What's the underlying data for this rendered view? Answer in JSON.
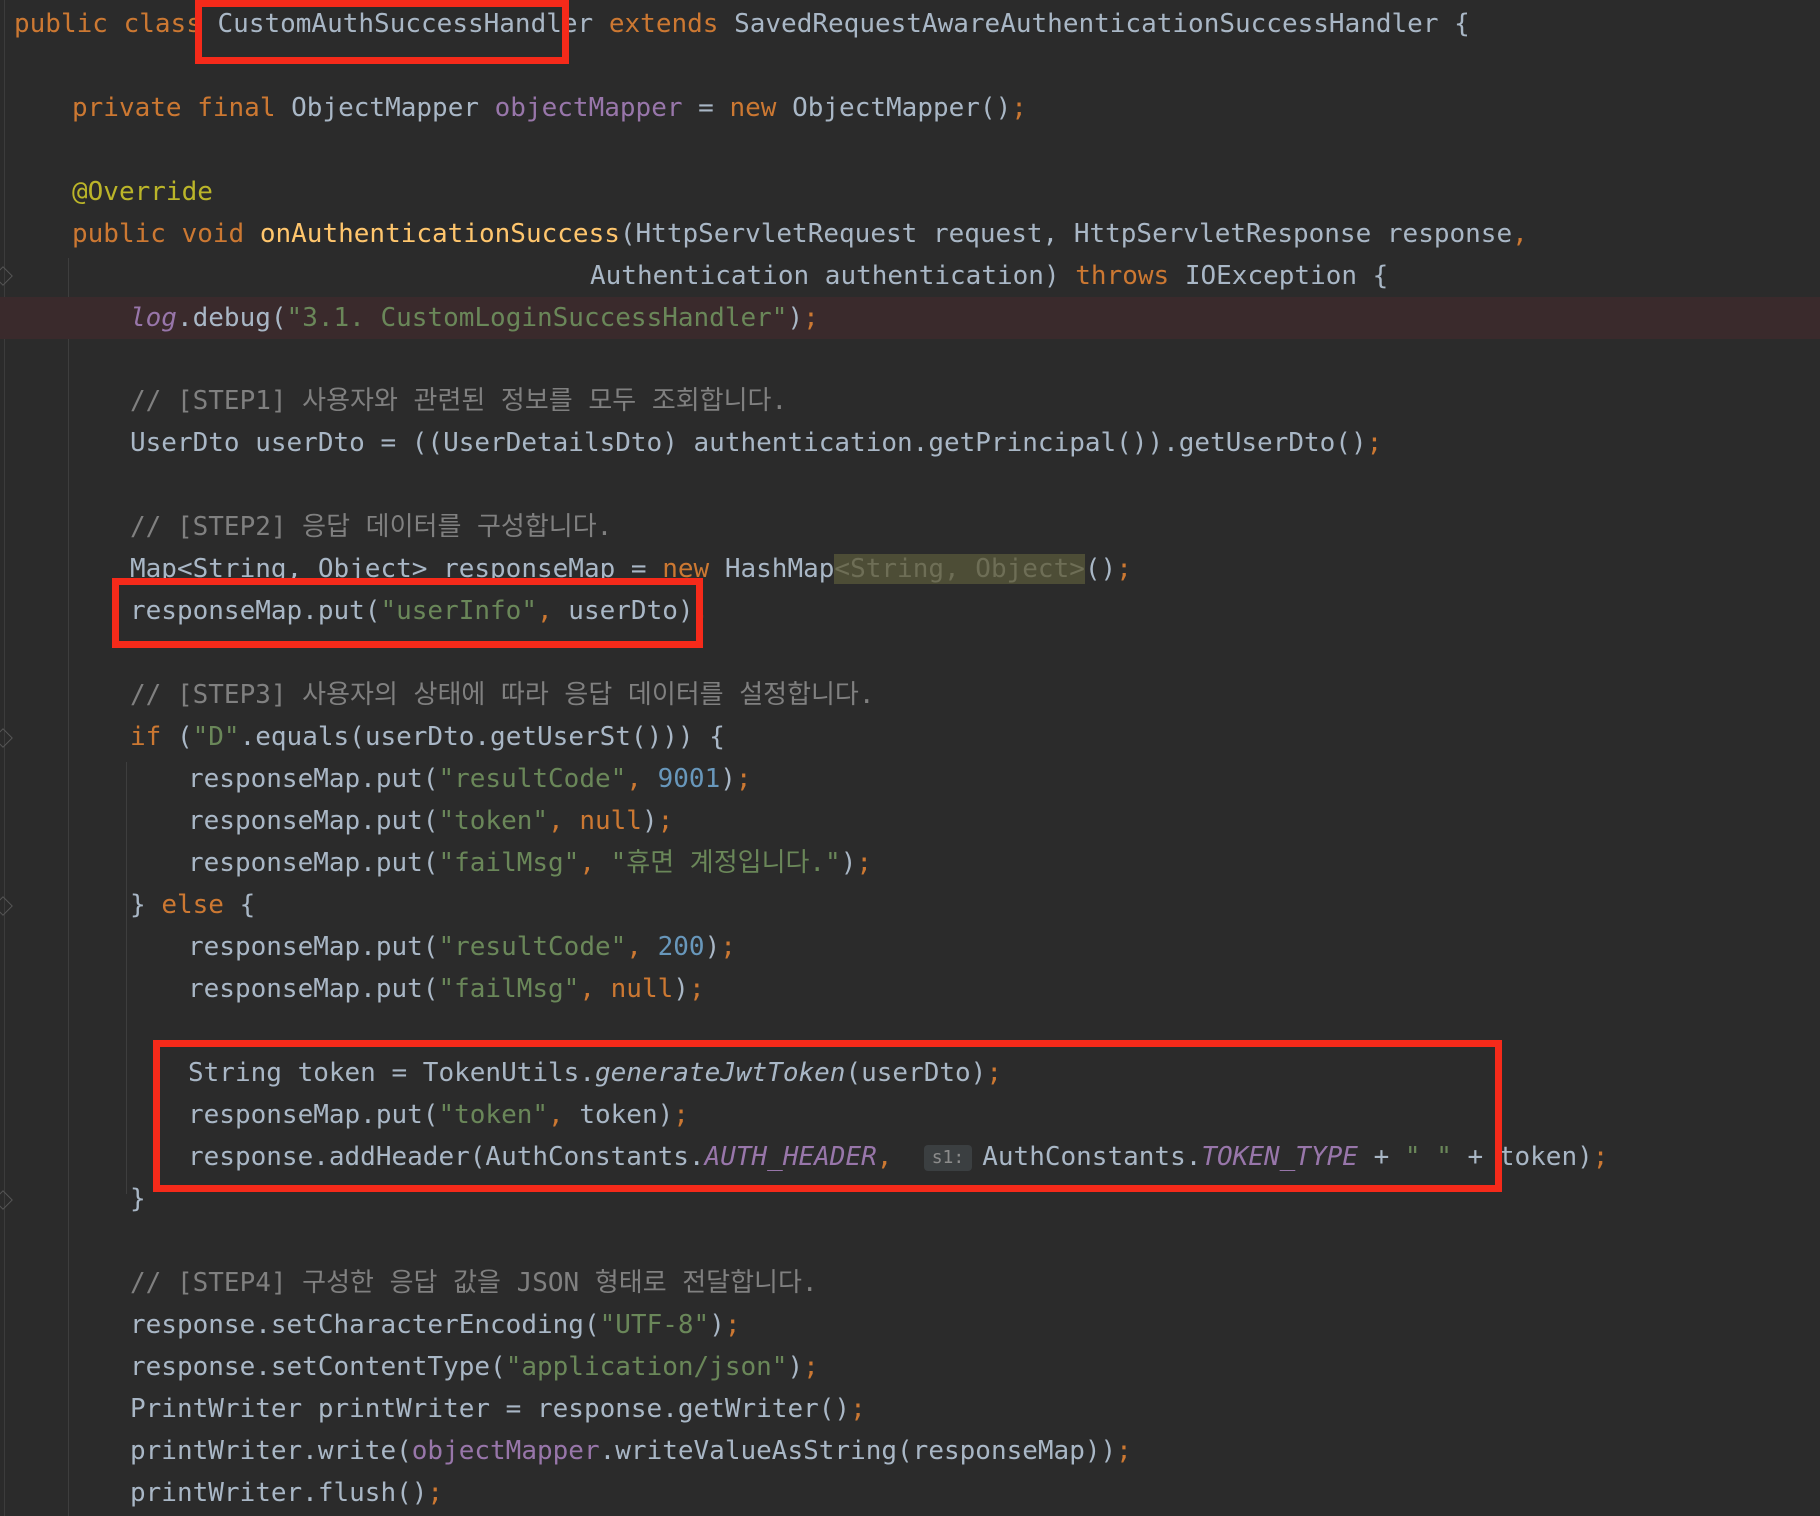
{
  "code": {
    "l1": {
      "pub": "public",
      "cls": "class",
      "name": "CustomAuthSuccessHandler",
      "ext": "extends",
      "parent": "SavedRequestAwareAuthenticationSuccessHandler",
      "brace": "{"
    },
    "l2": {
      "kw": "private final",
      "type": "ObjectMapper",
      "field": "objectMapper",
      "eq": "=",
      "new": "new",
      "ctor": "ObjectMapper()",
      "semi": ";"
    },
    "l3": {
      "ann": "@Override"
    },
    "l4": {
      "kw": "public void",
      "method": "onAuthenticationSuccess",
      "params": "(HttpServletRequest request, HttpServletResponse response",
      "comma": ","
    },
    "l5": {
      "params": "Authentication authentication)",
      "throws": "throws",
      "exc": "IOException {"
    },
    "l6": {
      "log": "log",
      "call": ".debug(",
      "str": "\"3.1. CustomLoginSuccessHandler\"",
      "end": ")",
      "semi": ";"
    },
    "l7": {
      "cmt": "// [STEP1] 사용자와 관련된 정보를 모두 조회합니다."
    },
    "l8": {
      "code": "UserDto userDto = ((UserDetailsDto) authentication.getPrincipal()).getUserDto()",
      "semi": ";"
    },
    "l9": {
      "cmt": "// [STEP2] 응답 데이터를 구성합니다."
    },
    "l10": {
      "a": "Map<String, Object> responseMap = ",
      "new": "new",
      "b": " HashMap",
      "lt": "<",
      "hint": "String, Object",
      "gt": ">",
      "c": "()",
      "semi": ";"
    },
    "l11": {
      "a": "responseMap.put(",
      "str": "\"userInfo\"",
      "comma": ",",
      "b": " userDto)",
      "semi": ";"
    },
    "l12": {
      "cmt": "// [STEP3] 사용자의 상태에 따라 응답 데이터를 설정합니다."
    },
    "l13": {
      "if": "if",
      "a": " (",
      "str": "\"D\"",
      "b": ".equals(userDto.getUserSt())) {"
    },
    "l14": {
      "a": "responseMap.put(",
      "str": "\"resultCode\"",
      "comma": ",",
      "num": "9001",
      "b": ")",
      "semi": ";"
    },
    "l15": {
      "a": "responseMap.put(",
      "str": "\"token\"",
      "comma": ",",
      "null": "null",
      "b": ")",
      "semi": ";"
    },
    "l16": {
      "a": "responseMap.put(",
      "str": "\"failMsg\"",
      "comma": ",",
      "str2": "\"휴면 계정입니다.\"",
      "b": ")",
      "semi": ";"
    },
    "l17": {
      "a": "} ",
      "else": "else",
      "b": " {"
    },
    "l18": {
      "a": "responseMap.put(",
      "str": "\"resultCode\"",
      "comma": ",",
      "num": "200",
      "b": ")",
      "semi": ";"
    },
    "l19": {
      "a": "responseMap.put(",
      "str": "\"failMsg\"",
      "comma": ",",
      "null": "null",
      "b": ")",
      "semi": ";"
    },
    "l20": {
      "a": "String token = TokenUtils.",
      "m": "generateJwtToken",
      "b": "(userDto)",
      "semi": ";"
    },
    "l21": {
      "a": "responseMap.put(",
      "str": "\"token\"",
      "comma": ",",
      "b": " token)",
      "semi": ";"
    },
    "l22": {
      "a": "response.addHeader(AuthConstants.",
      "f1": "AUTH_HEADER",
      "comma": ",",
      "hint": "s1:",
      "b": "AuthConstants.",
      "f2": "TOKEN_TYPE",
      "c": " + ",
      "str": "\" \"",
      "d": " + token)",
      "semi": ";"
    },
    "l23": {
      "a": "}"
    },
    "l24": {
      "cmt": "// [STEP4] 구성한 응답 값을 JSON 형태로 전달합니다."
    },
    "l25": {
      "a": "response.setCharacterEncoding(",
      "str": "\"UTF-8\"",
      "b": ")",
      "semi": ";"
    },
    "l26": {
      "a": "response.setContentType(",
      "str": "\"application/json\"",
      "b": ")",
      "semi": ";"
    },
    "l27": {
      "a": "PrintWriter printWriter = response.getWriter()",
      "semi": ";"
    },
    "l28": {
      "a": "printWriter.write(",
      "field": "objectMapper",
      "b": ".writeValueAsString(responseMap))",
      "semi": ";"
    },
    "l29": {
      "a": "printWriter.flush()",
      "semi": ";"
    }
  },
  "colors": {
    "background": "#2b2b2b",
    "keyword": "#cc7832",
    "string": "#6a8759",
    "comment": "#808080",
    "field": "#9876aa",
    "highlight_box": "#f52a1a"
  }
}
